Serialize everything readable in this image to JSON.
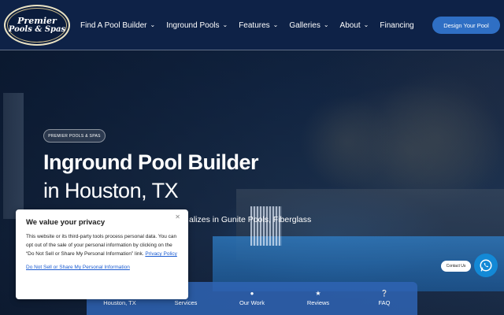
{
  "header": {
    "logo": {
      "line1": "Premier",
      "line2": "Pools & Spas"
    },
    "nav": [
      {
        "label": "Find A Pool Builder",
        "dropdown": true
      },
      {
        "label": "Inground Pools",
        "dropdown": true
      },
      {
        "label": "Features",
        "dropdown": true
      },
      {
        "label": "Galleries",
        "dropdown": true
      },
      {
        "label": "About",
        "dropdown": true
      },
      {
        "label": "Financing",
        "dropdown": false
      }
    ],
    "cta_label": "Design Your Pool"
  },
  "hero": {
    "badge": "PREMIER POOLS & SPAS",
    "title_line1": "Inground Pool Builder",
    "title_line2": "in Houston, TX",
    "subtitle_visible": "alizes in Gunite Pools, Fiberglass"
  },
  "quick_nav": [
    {
      "label": "Houston, TX",
      "icon": "location-icon"
    },
    {
      "label": "Services",
      "icon": "tools-icon"
    },
    {
      "label": "Our Work",
      "icon": "map-pin-icon"
    },
    {
      "label": "Reviews",
      "icon": "star-icon"
    },
    {
      "label": "FAQ",
      "icon": "question-icon"
    }
  ],
  "contact": {
    "label": "Contact Us",
    "icon": "whatsapp-icon"
  },
  "privacy_popup": {
    "title": "We value your privacy",
    "body": "This website or its third-party tools process personal data. You can opt out of the sale of your personal information by clicking on the “Do Not Sell or Share My Personal Information” link.",
    "policy_link": "Privacy Policy",
    "optout_link": "Do Not Sell or Share My Personal Information",
    "close_icon": "close-icon"
  },
  "colors": {
    "header_bg": "#0e2247",
    "accent": "#2f6fc4",
    "quicknav_bg": "#2f64b4",
    "whatsapp_btn": "#1389d6",
    "link": "#1a5bd1"
  }
}
